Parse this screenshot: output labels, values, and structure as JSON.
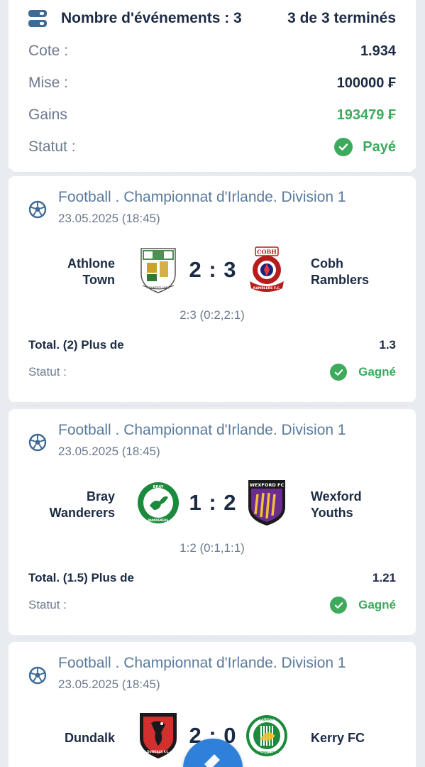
{
  "summary": {
    "title": "Nombre d'événements : 3",
    "completed": "3 de 3 terminés",
    "odds_label": "Cote :",
    "odds_value": "1.934",
    "stake_label": "Mise :",
    "stake_value": "100000 ₣",
    "winnings_label": "Gains",
    "winnings_value": "193479 ₣",
    "status_label": "Statut :",
    "status_value": "Payé"
  },
  "events": [
    {
      "league": "Football . Championnat d'Irlande. Division 1",
      "date": "23.05.2025 (18:45)",
      "home_line1": "Athlone",
      "home_line2": "Town",
      "away_line1": "Cobh",
      "away_line2": "Ramblers",
      "score": "2 : 3",
      "detail": "2:3 (0:2,2:1)",
      "bet_label": "Total. (2) Plus de",
      "bet_odds": "1.3",
      "status_label": "Statut :",
      "status_value": "Gagné",
      "home_logo_text": "FOUNDED 1887",
      "away_logo_top": "COBH",
      "away_logo_bottom": "RAMBLERS F.C."
    },
    {
      "league": "Football . Championnat d'Irlande. Division 1",
      "date": "23.05.2025 (18:45)",
      "home_line1": "Bray",
      "home_line2": "Wanderers",
      "away_line1": "Wexford",
      "away_line2": "Youths",
      "score": "1 : 2",
      "detail": "1:2 (0:1,1:1)",
      "bet_label": "Total. (1.5) Plus de",
      "bet_odds": "1.21",
      "status_label": "Statut :",
      "status_value": "Gagné",
      "home_logo_top": "BRAY",
      "home_logo_bottom": "WANDERERS",
      "away_logo_text": "WEXFORD FC"
    },
    {
      "league": "Football . Championnat d'Irlande. Division 1",
      "date": "23.05.2025 (18:45)",
      "home_line1": "Dundalk",
      "away_line1": "Kerry FC",
      "score": "2 : 0",
      "home_logo_text": "DUNDALK F.C.",
      "away_logo_top": "KERRY",
      "away_logo_bottom": "FOOTBALL CLUB"
    }
  ],
  "colors": {
    "background": "#e8ecf1",
    "card": "#ffffff",
    "text_dark": "#1c2b45",
    "text_muted": "#6b7a8e",
    "league_blue": "#5a7a9c",
    "success_green": "#3daa5c",
    "fab_blue": "#2f80d8"
  },
  "icons": {
    "summary": "event-counter-icon",
    "sport": "soccer-ball-icon",
    "status": "check-circle-icon",
    "fab": "pencil-icon"
  }
}
